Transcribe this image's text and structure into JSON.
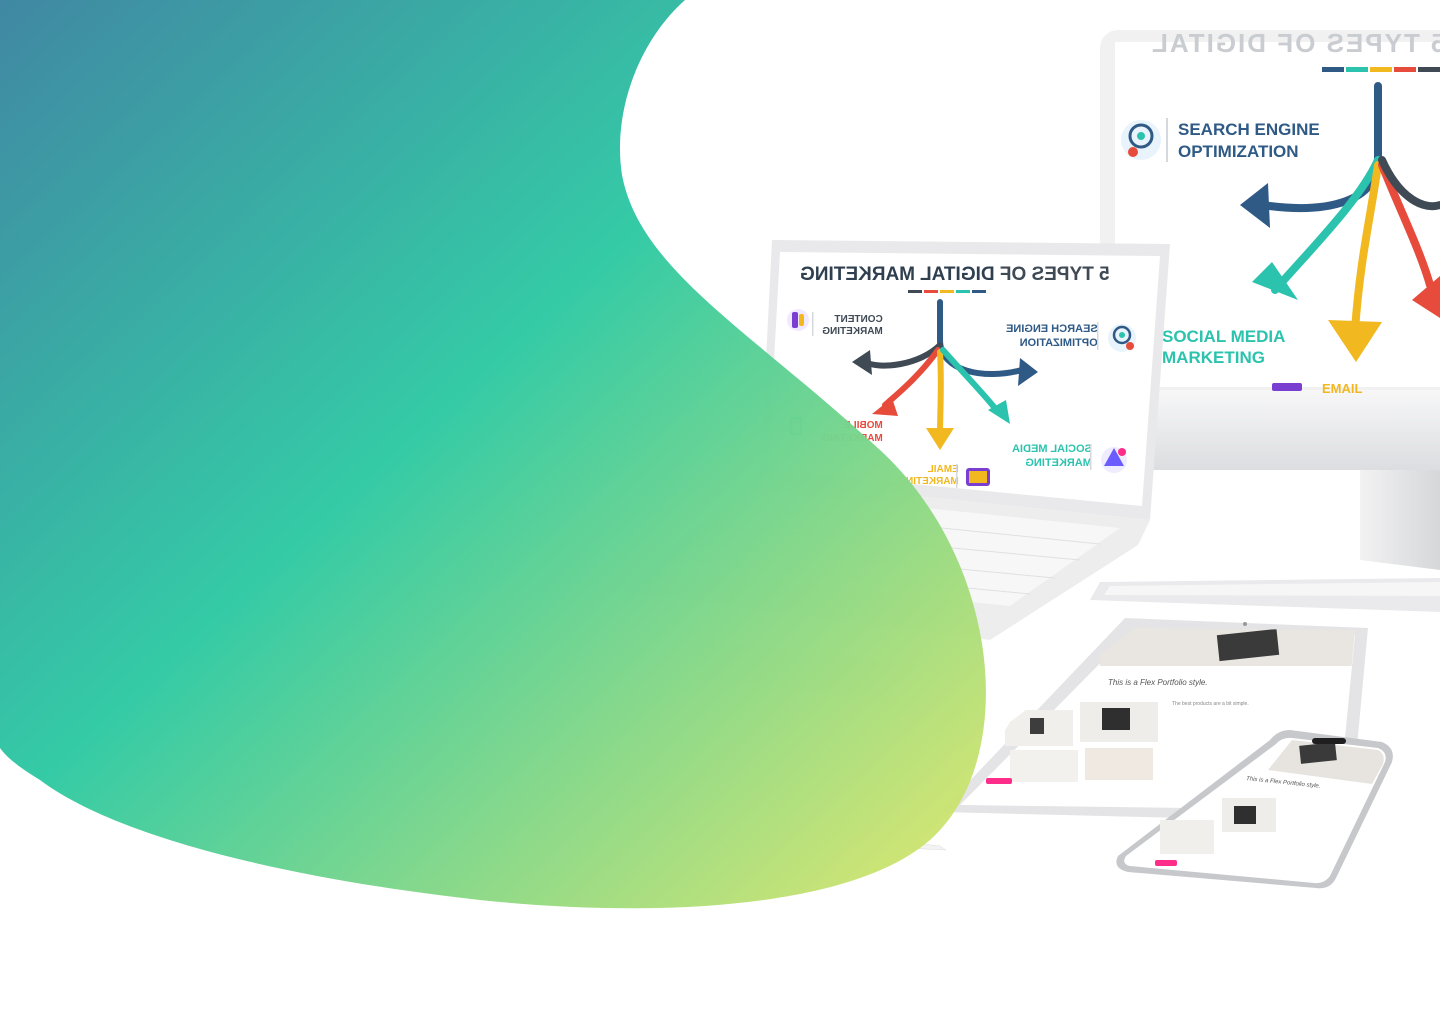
{
  "colors": {
    "blob_gradient": [
      "#3a84a0",
      "#2ec9a3",
      "#e2e76a"
    ],
    "navy": "#2f5a86",
    "teal": "#2cc3ae",
    "yellow": "#f2b820",
    "red": "#e64b3c",
    "slate": "#3f4a55",
    "accent_pink": "#ff2d8a"
  },
  "monitor_slide": {
    "partial_title": "5 TYPES OF DIGITAL",
    "seo_line1": "SEARCH ENGINE",
    "seo_line2": "OPTIMIZATION",
    "social_line1": "SOCIAL MEDIA",
    "social_line2": "MARKETING",
    "email_partial": "EMAIL"
  },
  "laptop_slide": {
    "title_prefix": "5 TYPES OF ",
    "title_highlight": "DIGITAL MARKETING",
    "content_line1": "CONTENT",
    "content_line2": "MARKETING",
    "seo_line1": "SEARCH ENGINE",
    "seo_line2": "OPTIMIZATION",
    "mobile_line1": "MOBILE",
    "mobile_line2": "MARKETING",
    "social_line1": "SOCIAL MEDIA",
    "social_line2": "MARKETING",
    "email_line1": "EMAIL",
    "email_line2": "MARKETING"
  },
  "tablet_screen": {
    "tagline": "This is a Flex Portfolio style.",
    "side_note": "The best products are a bit simple."
  },
  "phone_screen": {
    "tagline": "This is a Flex Portfolio style."
  },
  "icons": [
    "seo-target-icon",
    "content-marketing-icon",
    "mobile-marketing-icon",
    "social-media-icon",
    "email-marketing-icon"
  ]
}
